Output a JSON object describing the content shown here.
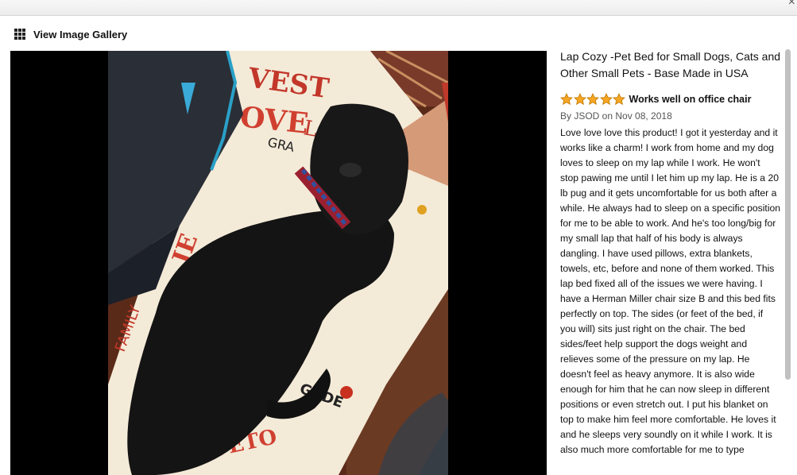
{
  "window": {
    "close_label": "×"
  },
  "gallery": {
    "label": "View Image Gallery",
    "icon": "grid-icon"
  },
  "image": {
    "description": "user-photo"
  },
  "product": {
    "title": "Lap Cozy -Pet Bed for Small Dogs, Cats and Other Small Pets - Base Made in USA"
  },
  "review": {
    "rating": 5,
    "max_rating": 5,
    "star_color": "#f5a623",
    "title": "Works well on office chair",
    "byline": "By JSOD on Nov 08, 2018",
    "body": "Love love love this product! I got it yesterday and it works like a charm! I work from home and my dog loves to sleep on my lap while I work. He won't stop pawing me until I let him up my lap. He is a 20 lb pug and it gets uncomfortable for us both after a while. He always had to sleep on a specific position for me to be able to work. And he's too long/big for my small lap that half of his body is always dangling. I have used pillows, extra blankets, towels, etc, before and none of them worked. This lap bed fixed all of the issues we were having. I have a Herman Miller chair size B and this bed fits perfectly on top. The sides (or feet of the bed, if you will) sits just right on the chair. The bed sides/feet help support the dogs weight and relieves some of the pressure on my lap. He doesn't feel as heavy anymore. It is also wide enough for him that he can now sleep in different positions or even stretch out. I put his blanket on top to make him feel more comfortable. He loves it and he sleeps very soundly on it while I work. It is also much more comfortable for me to type"
  }
}
